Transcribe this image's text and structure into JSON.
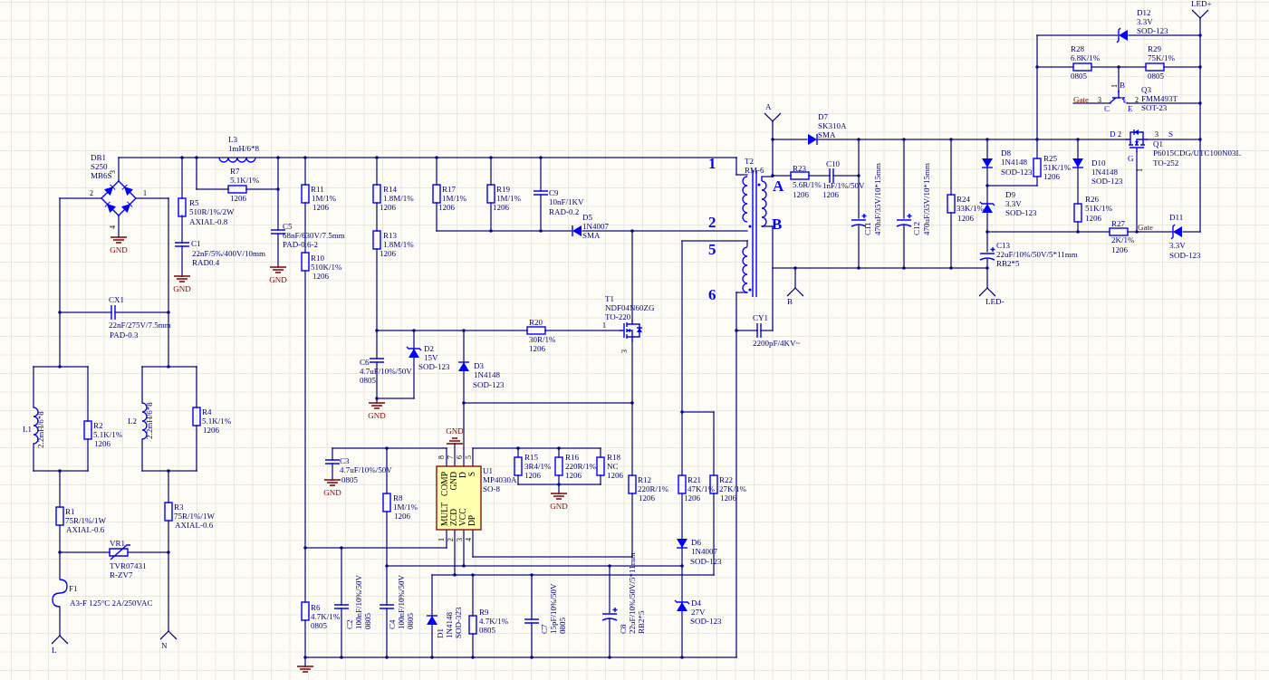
{
  "schematic": {
    "components": [
      {
        "kind": "bridge",
        "lines": [
          "DB1",
          "S250",
          "MB6S"
        ],
        "pins": [
          "3",
          "2",
          "1",
          "4"
        ]
      },
      {
        "kind": "inductor",
        "lines": [
          "L3",
          "1mH/6*8"
        ]
      },
      {
        "kind": "resistor",
        "lines": [
          "R7",
          "5.1K/1%",
          "1206"
        ]
      },
      {
        "kind": "resistor",
        "lines": [
          "R5",
          "510R/1%/2W",
          "AXIAL-0.8"
        ]
      },
      {
        "kind": "capacitor",
        "lines": [
          "C1",
          "22nF/5%/400V/10mm",
          "RAD0.4"
        ]
      },
      {
        "kind": "resistor",
        "lines": [
          "R11",
          "1M/1%",
          "1206"
        ]
      },
      {
        "kind": "capacitor",
        "lines": [
          "C5",
          "68nF/630V/7.5mm",
          "PAD-0.6-2"
        ]
      },
      {
        "kind": "resistor",
        "lines": [
          "R10",
          "510K/1%",
          "1206"
        ]
      },
      {
        "kind": "resistor",
        "lines": [
          "R14",
          "1.8M/1%",
          "1206"
        ]
      },
      {
        "kind": "resistor",
        "lines": [
          "R13",
          "1.8M/1%",
          "1206"
        ]
      },
      {
        "kind": "capacitor",
        "lines": [
          "CX1",
          "22nF/275V/7.5mm",
          "PAD-0.3"
        ]
      },
      {
        "kind": "inductor",
        "lines": [
          "L1",
          "2.2mH/6*8"
        ]
      },
      {
        "kind": "resistor",
        "lines": [
          "R2",
          "5.1K/1%",
          "1206"
        ]
      },
      {
        "kind": "inductor",
        "lines": [
          "L2",
          "2.2mH/6*8"
        ]
      },
      {
        "kind": "resistor",
        "lines": [
          "R4",
          "5.1K/1%",
          "1206"
        ]
      },
      {
        "kind": "resistor",
        "lines": [
          "R1",
          "75R/1%/1W",
          "AXIAL-0.6"
        ]
      },
      {
        "kind": "resistor",
        "lines": [
          "R3",
          "75R/1%/1W",
          "AXIAL-0.6"
        ]
      },
      {
        "kind": "varistor",
        "lines": [
          "VR1",
          "TVR07431",
          "R-ZV7"
        ]
      },
      {
        "kind": "fuse",
        "lines": [
          "F1",
          "A3-F 125°C 2A/250VAC"
        ]
      },
      {
        "kind": "capacitor",
        "lines": [
          "C6",
          "4.7uF/10%/50V",
          "0805"
        ]
      },
      {
        "kind": "zener",
        "lines": [
          "D2",
          "15V",
          "SOD-123"
        ]
      },
      {
        "kind": "diode",
        "lines": [
          "D3",
          "1N4148",
          "SOD-123"
        ]
      },
      {
        "kind": "resistor",
        "lines": [
          "R20",
          "30R/1%",
          "1206"
        ]
      },
      {
        "kind": "mosfet",
        "lines": [
          "T1",
          "NDF04N60ZG",
          "TO-220"
        ],
        "pins": [
          "1",
          "3"
        ]
      },
      {
        "kind": "resistor",
        "lines": [
          "R17",
          "1M/1%",
          "1206"
        ]
      },
      {
        "kind": "resistor",
        "lines": [
          "R19",
          "1M/1%",
          "1206"
        ]
      },
      {
        "kind": "capacitor",
        "lines": [
          "C9",
          "10nF/1KV",
          "RAD-0.2"
        ]
      },
      {
        "kind": "diode",
        "lines": [
          "D5",
          "1N4007",
          "SMA"
        ]
      },
      {
        "kind": "transformer",
        "lines": [
          "T2",
          "RM-6"
        ],
        "winding_numbers": [
          "1",
          "2",
          "5",
          "6"
        ],
        "winding_letters": [
          "A",
          "B"
        ]
      },
      {
        "kind": "capacitor",
        "lines": [
          "CY1",
          "2200pF/4KV~"
        ]
      },
      {
        "kind": "capacitor",
        "lines": [
          "C3",
          "4.7uF/10%/50V",
          "0805"
        ]
      },
      {
        "kind": "resistor",
        "lines": [
          "R8",
          "1M/1%",
          "1206"
        ]
      },
      {
        "kind": "ic",
        "lines": [
          "U1",
          "MP4030A",
          "SO-8"
        ],
        "pins": [
          "8",
          "7",
          "6",
          "5",
          "1",
          "2",
          "3",
          "4"
        ],
        "pin_names": [
          "COMP",
          "GND",
          "D",
          "S",
          "MULT",
          "ZCD",
          "VCC",
          "DP"
        ]
      },
      {
        "kind": "resistor",
        "lines": [
          "R15",
          "3R4/1%",
          "1206"
        ]
      },
      {
        "kind": "resistor",
        "lines": [
          "R16",
          "220R/1%",
          "1206"
        ]
      },
      {
        "kind": "resistor",
        "lines": [
          "R18",
          "NC",
          "1206"
        ]
      },
      {
        "kind": "resistor",
        "lines": [
          "R12",
          "220R/1%",
          "1206"
        ]
      },
      {
        "kind": "resistor",
        "lines": [
          "R21",
          "47K/1%",
          "1206"
        ]
      },
      {
        "kind": "resistor",
        "lines": [
          "R22",
          "27K/1%",
          "1206"
        ]
      },
      {
        "kind": "diode",
        "lines": [
          "D6",
          "1N4007",
          "SOD-123"
        ]
      },
      {
        "kind": "zener",
        "lines": [
          "D4",
          "27V",
          "SOD-123"
        ]
      },
      {
        "kind": "resistor",
        "lines": [
          "R6",
          "4.7K/1%",
          "0805"
        ]
      },
      {
        "kind": "capacitor",
        "lines": [
          "C2",
          "100nF/10%/50V",
          "0805"
        ]
      },
      {
        "kind": "capacitor",
        "lines": [
          "C4",
          "100nF/10%/50V",
          "0805"
        ]
      },
      {
        "kind": "diode",
        "lines": [
          "D1",
          "1N4148",
          "SOD-323"
        ]
      },
      {
        "kind": "resistor",
        "lines": [
          "R9",
          "4.7K/1%",
          "0805"
        ]
      },
      {
        "kind": "capacitor",
        "lines": [
          "C7",
          "15pF/10%/50V",
          "0805"
        ]
      },
      {
        "kind": "electrolytic",
        "lines": [
          "C8",
          "22uF/10%/50V/5*11mm",
          "RB2*5"
        ]
      },
      {
        "kind": "diode",
        "lines": [
          "D7",
          "SK310A",
          "SMA"
        ]
      },
      {
        "kind": "resistor",
        "lines": [
          "R23",
          "5.6R/1%",
          "1206"
        ]
      },
      {
        "kind": "capacitor",
        "lines": [
          "C10",
          "1nF/1%/50V",
          "1206"
        ]
      },
      {
        "kind": "electrolytic",
        "lines": [
          "C11",
          "470uF/35V/10*15mm"
        ]
      },
      {
        "kind": "electrolytic",
        "lines": [
          "C12",
          "470uF/35V/10*15mm"
        ]
      },
      {
        "kind": "resistor",
        "lines": [
          "R24",
          "33K/1%",
          "1206"
        ]
      },
      {
        "kind": "zener",
        "lines": [
          "D12",
          "3.3V",
          "SOD-123"
        ]
      },
      {
        "kind": "resistor",
        "lines": [
          "R28",
          "6.8K/1%",
          "0805"
        ]
      },
      {
        "kind": "resistor",
        "lines": [
          "R29",
          "75K/1%",
          "0805"
        ]
      },
      {
        "kind": "bjt",
        "lines": [
          "Q3",
          "FMM493T",
          "SOT-23"
        ],
        "pins": [
          "1",
          "3",
          "2"
        ],
        "pin_letters": [
          "B",
          "C",
          "E"
        ]
      },
      {
        "kind": "mosfet",
        "lines": [
          "Q1",
          "P6015CDG/UTC100N03L",
          "TO-252"
        ],
        "pins": [
          "2",
          "3",
          "1"
        ],
        "pin_letters": [
          "D",
          "S",
          "G"
        ]
      },
      {
        "kind": "diode",
        "lines": [
          "D8",
          "1N4148",
          "SOD-123"
        ]
      },
      {
        "kind": "zener",
        "lines": [
          "D9",
          "3.3V",
          "SOD-123"
        ]
      },
      {
        "kind": "resistor",
        "lines": [
          "R25",
          "51K/1%",
          "1206"
        ]
      },
      {
        "kind": "diode",
        "lines": [
          "D10",
          "1N4148",
          "SOD-123"
        ]
      },
      {
        "kind": "resistor",
        "lines": [
          "R26",
          "51K/1%",
          "1206"
        ]
      },
      {
        "kind": "electrolytic",
        "lines": [
          "C13",
          "22uF/10%/50V/5*11mm",
          "RB2*5"
        ]
      },
      {
        "kind": "resistor",
        "lines": [
          "R27",
          "2K/1%",
          "1206"
        ]
      },
      {
        "kind": "zener",
        "lines": [
          "D11",
          "3.3V",
          "SOD-123"
        ]
      }
    ],
    "grounds": [
      {
        "label": "GND"
      },
      {
        "label": "GND"
      },
      {
        "label": "GND"
      },
      {
        "label": "GND"
      },
      {
        "label": "GND"
      },
      {
        "label": "GND"
      },
      {
        "label": "GND"
      }
    ],
    "ports": [
      {
        "label": "L"
      },
      {
        "label": "N"
      },
      {
        "label": "A"
      },
      {
        "label": "B"
      },
      {
        "label": "LED-"
      },
      {
        "label": "LED+"
      }
    ],
    "net_labels": [
      {
        "text": "Gate"
      },
      {
        "text": "Gate"
      }
    ]
  }
}
